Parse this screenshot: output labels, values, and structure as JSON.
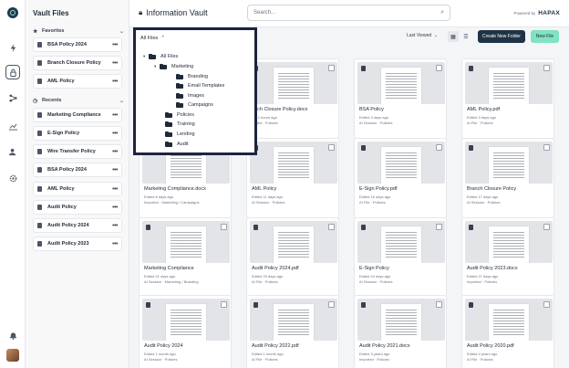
{
  "app": {
    "title": "Information Vault"
  },
  "search": {
    "placeholder": "Search..."
  },
  "powered": {
    "label": "Powered by",
    "brand": "HAPAX"
  },
  "sidebar": {
    "title": "Vault Files",
    "favorites_label": "Favorites",
    "favorites": [
      "BSA Policy 2024",
      "Branch Closure Policy",
      "AML Policy"
    ],
    "recents_label": "Recents",
    "recents": [
      "Marketing Compliance",
      "E-Sign Policy",
      "Wire Transfer Policy",
      "BSA Policy 2024",
      "AML Policy",
      "Audit Policy",
      "Audit Policy 2024",
      "Audit Policy 2023"
    ]
  },
  "toolbar": {
    "sort_label": "Last Viewed",
    "new_folder": "Create New Folder",
    "new_file": "New File"
  },
  "popup": {
    "header": "All Files",
    "tree": [
      {
        "label": "All Files",
        "caret": "▾"
      },
      {
        "label": "Marketing",
        "caret": "▾"
      },
      {
        "label": "Branding",
        "caret": ""
      },
      {
        "label": "Email Templates",
        "caret": ""
      },
      {
        "label": "Images",
        "caret": ""
      },
      {
        "label": "Campaigns",
        "caret": ""
      },
      {
        "label": "Policies",
        "caret": ""
      },
      {
        "label": "Training",
        "caret": ""
      },
      {
        "label": "Lending",
        "caret": ""
      },
      {
        "label": "Audit",
        "caret": ""
      }
    ]
  },
  "cards": [
    {
      "name": "",
      "edited": "",
      "source": ""
    },
    {
      "name": "anch Closure Policy.docx",
      "edited": "ted 2 hours ago",
      "source": "ported · Policies"
    },
    {
      "name": "BSA Policy",
      "edited": "Edited 3 days ago",
      "source": "AI Session · Policies"
    },
    {
      "name": "AML Policy.pdf",
      "edited": "Edited 3 days ago",
      "source": "AI File · Policies"
    },
    {
      "name": "Marketing Compliance.docx",
      "edited": "Edited 8 days ago",
      "source": "Imported · Marketing / Campaigns"
    },
    {
      "name": "AML Policy",
      "edited": "Edited 11 days ago",
      "source": "AI Session · Policies"
    },
    {
      "name": "E-Sign Policy.pdf",
      "edited": "Edited 16 days ago",
      "source": "AI File · Policies"
    },
    {
      "name": "Branch Closure Policy",
      "edited": "Edited 17 days ago",
      "source": "AI Session · Policies"
    },
    {
      "name": "Marketing Compliance",
      "edited": "Edited 21 days ago",
      "source": "AI Session · Marketing / Branding"
    },
    {
      "name": "Audit Policy 2024.pdf",
      "edited": "Edited 23 days ago",
      "source": "AI File · Policies"
    },
    {
      "name": "E-Sign Policy",
      "edited": "Edited 24 days ago",
      "source": "AI Session · Policies"
    },
    {
      "name": "Audit Policy 2023.docx",
      "edited": "Edited 27 days ago",
      "source": "Imported · Policies"
    },
    {
      "name": "Audit Policy 2024",
      "edited": "Edited 1 month ago",
      "source": "AI Session · Policies"
    },
    {
      "name": "Audit Policy 2022.pdf",
      "edited": "Edited 1 month ago",
      "source": "AI File · Policies"
    },
    {
      "name": "Audit Policy 2021.docx",
      "edited": "Edited 3 years ago",
      "source": "Imported · Policies"
    },
    {
      "name": "Audit Policy 2020.pdf",
      "edited": "Edited 4 years ago",
      "source": "AI File · Policies"
    }
  ],
  "colors": {
    "accent": "#7fe3c3",
    "primary": "#1f3346",
    "popup_border": "#1c2440"
  }
}
